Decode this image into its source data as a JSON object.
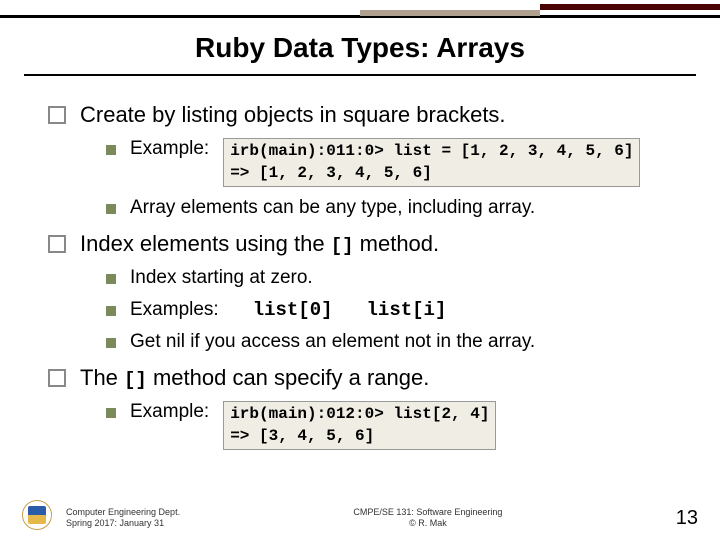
{
  "title": "Ruby Data Types: Arrays",
  "b1": {
    "text": "Create by listing objects in square brackets.",
    "s1": "Example:",
    "code1": "irb(main):011:0> list = [1, 2, 3, 4, 5, 6]\n=> [1, 2, 3, 4, 5, 6]",
    "s2": "Array elements can be any type, including array."
  },
  "b2": {
    "prefix": "Index elements using the ",
    "code": "[]",
    "suffix": " method.",
    "s1": "Index starting at zero.",
    "s2": "Examples:",
    "ex1": "list[0]",
    "ex2": "list[i]",
    "s3": "Get nil if you access an element not in the array."
  },
  "b3": {
    "prefix": "The ",
    "code": "[]",
    "suffix": " method can specify a range.",
    "s1": "Example:",
    "code1": "irb(main):012:0> list[2, 4]\n=> [3, 4, 5, 6]"
  },
  "footer": {
    "left1": "Computer Engineering Dept.",
    "left2": "Spring 2017: January 31",
    "center1": "CMPE/SE 131: Software Engineering",
    "center2": "© R. Mak",
    "page": "13"
  }
}
